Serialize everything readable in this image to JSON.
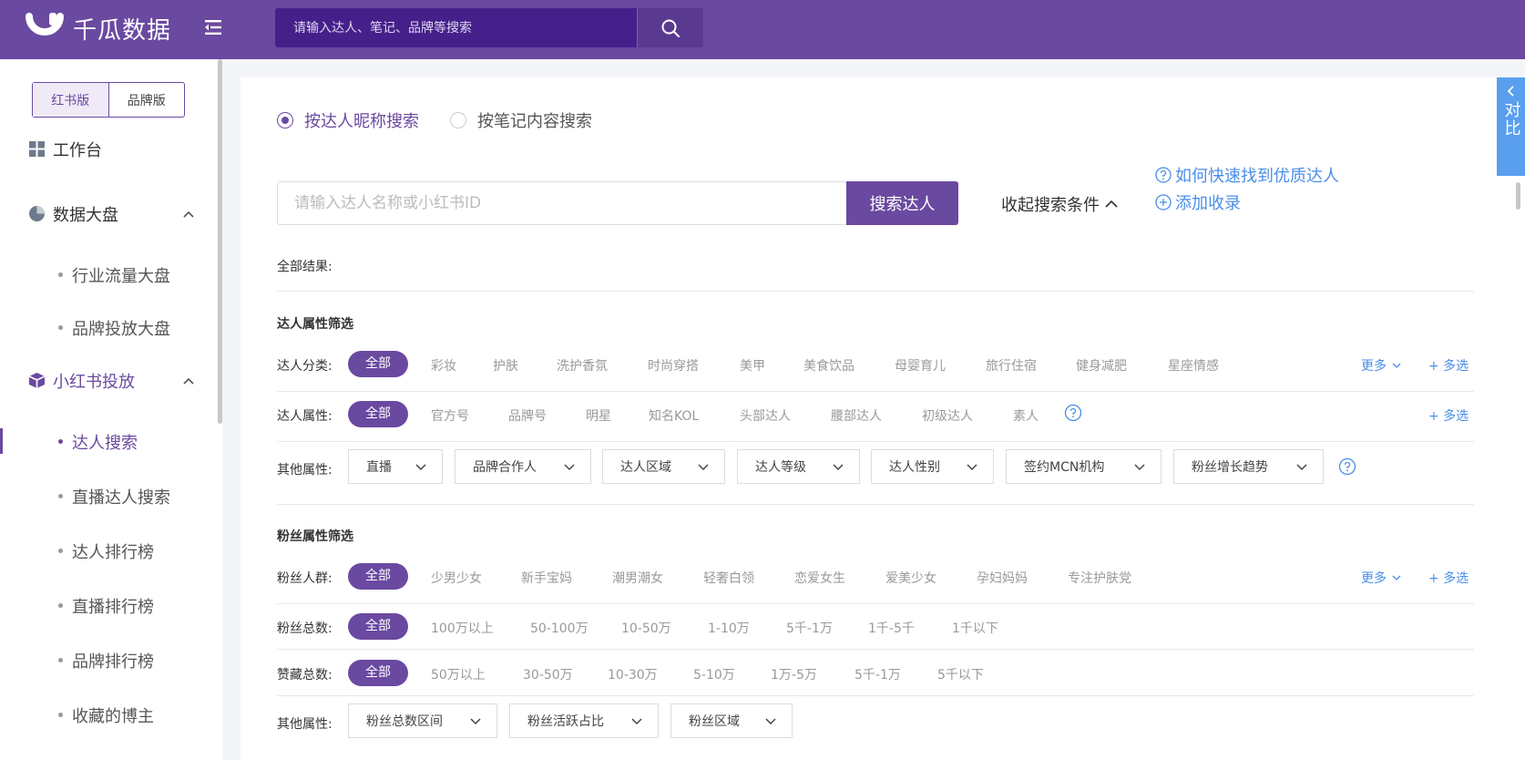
{
  "app": {
    "name": "千瓜数据"
  },
  "header": {
    "search_placeholder": "请输入达人、笔记、品牌等搜索"
  },
  "sidebar": {
    "versions": [
      "红书版",
      "品牌版"
    ],
    "workbench": "工作台",
    "data_board": {
      "label": "数据大盘",
      "items": [
        "行业流量大盘",
        "品牌投放大盘"
      ]
    },
    "xhs": {
      "label": "小红书投放",
      "items": [
        "达人搜索",
        "直播达人搜索",
        "达人排行榜",
        "直播排行榜",
        "品牌排行榜",
        "收藏的博主"
      ]
    }
  },
  "search_modes": [
    "按达人昵称搜索",
    "按笔记内容搜索"
  ],
  "search": {
    "placeholder": "请输入达人名称或小红书ID",
    "button": "搜索达人",
    "collapse": "收起搜索条件"
  },
  "links": {
    "how_to": "如何快速找到优质达人",
    "add_record": "添加收录"
  },
  "results_label": "全部结果:",
  "kol_filters": {
    "title": "达人属性筛选",
    "category": {
      "label": "达人分类:",
      "all": "全部",
      "options": [
        "彩妆",
        "护肤",
        "洗护香氛",
        "时尚穿搭",
        "美甲",
        "美食饮品",
        "母婴育儿",
        "旅行住宿",
        "健身减肥",
        "星座情感"
      ]
    },
    "attribute": {
      "label": "达人属性:",
      "all": "全部",
      "options": [
        "官方号",
        "品牌号",
        "明星",
        "知名KOL",
        "头部达人",
        "腰部达人",
        "初级达人",
        "素人"
      ]
    },
    "other": {
      "label": "其他属性:",
      "dropdowns": [
        "直播",
        "品牌合作人",
        "达人区域",
        "达人等级",
        "达人性别",
        "签约MCN机构",
        "粉丝增长趋势"
      ]
    }
  },
  "fan_filters": {
    "title": "粉丝属性筛选",
    "crowd": {
      "label": "粉丝人群:",
      "all": "全部",
      "options": [
        "少男少女",
        "新手宝妈",
        "潮男潮女",
        "轻奢白领",
        "恋爱女生",
        "爱美少女",
        "孕妇妈妈",
        "专注护肤党"
      ]
    },
    "total": {
      "label": "粉丝总数:",
      "all": "全部",
      "options": [
        "100万以上",
        "50-100万",
        "10-50万",
        "1-10万",
        "5千-1万",
        "1千-5千",
        "1千以下"
      ]
    },
    "likes": {
      "label": "赞藏总数:",
      "all": "全部",
      "options": [
        "50万以上",
        "30-50万",
        "10-30万",
        "5-10万",
        "1万-5万",
        "5千-1万",
        "5千以下"
      ]
    },
    "other": {
      "label": "其他属性:",
      "dropdowns": [
        "粉丝总数区间",
        "粉丝活跃占比",
        "粉丝区域"
      ]
    }
  },
  "common": {
    "more": "更多",
    "multi": "+ 多选"
  },
  "compare_tab": "对比",
  "colors": {
    "brand": "#6a49a0",
    "link": "#4a8ee8"
  }
}
